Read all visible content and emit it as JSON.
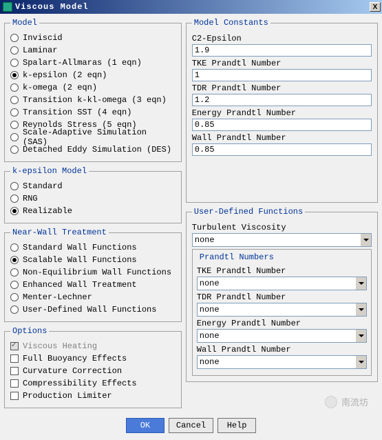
{
  "title": "Viscous Model",
  "close_x": "X",
  "groups": {
    "model": "Model",
    "kepsilon": "k-epsilon Model",
    "nearwall": "Near-Wall Treatment",
    "options": "Options",
    "constants": "Model Constants",
    "udf": "User-Defined Functions",
    "prandtl": "Prandtl Numbers"
  },
  "model": {
    "items": [
      "Inviscid",
      "Laminar",
      "Spalart-Allmaras (1 eqn)",
      "k-epsilon (2 eqn)",
      "k-omega (2 eqn)",
      "Transition k-kl-omega (3 eqn)",
      "Transition SST (4 eqn)",
      "Reynolds Stress (5 eqn)",
      "Scale-Adaptive Simulation (SAS)",
      "Detached Eddy Simulation (DES)"
    ],
    "selected": 3
  },
  "kepsilon": {
    "items": [
      "Standard",
      "RNG",
      "Realizable"
    ],
    "selected": 2
  },
  "nearwall": {
    "items": [
      "Standard Wall Functions",
      "Scalable Wall Functions",
      "Non-Equilibrium Wall Functions",
      "Enhanced Wall Treatment",
      "Menter-Lechner",
      "User-Defined Wall Functions"
    ],
    "selected": 1
  },
  "options": {
    "items": [
      {
        "label": "Viscous Heating",
        "checked": true,
        "disabled": true
      },
      {
        "label": "Full Buoyancy Effects",
        "checked": false,
        "disabled": false
      },
      {
        "label": "Curvature Correction",
        "checked": false,
        "disabled": false
      },
      {
        "label": "Compressibility Effects",
        "checked": false,
        "disabled": false
      },
      {
        "label": "Production Limiter",
        "checked": false,
        "disabled": false
      }
    ]
  },
  "constants": [
    {
      "label": "C2-Epsilon",
      "value": "1.9"
    },
    {
      "label": "TKE Prandtl Number",
      "value": "1"
    },
    {
      "label": "TDR Prandtl Number",
      "value": "1.2"
    },
    {
      "label": "Energy Prandtl Number",
      "value": "0.85"
    },
    {
      "label": "Wall Prandtl Number",
      "value": "0.85"
    }
  ],
  "udf": {
    "turb_visc_label": "Turbulent Viscosity",
    "turb_visc_value": "none",
    "prandtl": [
      {
        "label": "TKE Prandtl Number",
        "value": "none"
      },
      {
        "label": "TDR Prandtl Number",
        "value": "none"
      },
      {
        "label": "Energy Prandtl Number",
        "value": "none"
      },
      {
        "label": "Wall Prandtl Number",
        "value": "none"
      }
    ]
  },
  "buttons": {
    "ok": "OK",
    "cancel": "Cancel",
    "help": "Help"
  },
  "watermark": "南流坊"
}
